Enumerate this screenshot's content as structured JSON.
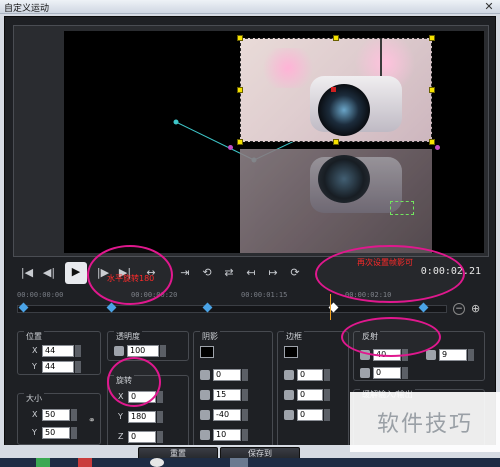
{
  "window": {
    "title": "自定义运动",
    "close": "✕"
  },
  "transport": {
    "buttons": [
      "|◀",
      "◀|",
      "▶",
      "|▶",
      "▶|",
      "↔"
    ],
    "timecode": "0:00:02.21"
  },
  "ruler": {
    "labels": [
      "00:00:00:00",
      "00:00:00:20",
      "00:00:01:15",
      "00:00:02:10"
    ]
  },
  "panels": {
    "position": {
      "title": "位置",
      "x_label": "X",
      "x_value": "44",
      "y_label": "Y",
      "y_value": "44"
    },
    "size": {
      "title": "大小",
      "x_label": "X",
      "x_value": "50",
      "y_label": "Y",
      "y_value": "50"
    },
    "opacity": {
      "title": "透明度",
      "value": "100"
    },
    "rotation": {
      "title": "旋转",
      "x_label": "X",
      "x_value": "0",
      "y_label": "Y",
      "y_value": "180",
      "z_label": "Z",
      "z_value": "0"
    },
    "shadow": {
      "title": "阴影",
      "v1": "0",
      "v2": "15",
      "v3": "-40",
      "v4": "10"
    },
    "border": {
      "title": "边框",
      "v1": "0",
      "v2": "0",
      "v3": "0"
    },
    "reflection": {
      "title": "反射",
      "v1": "40",
      "v2": "9",
      "v3": "0"
    },
    "ease": {
      "title": "缓解输入/输出"
    }
  },
  "annotations": {
    "rotate": "水平旋转180",
    "keyframe": "再次设置帧影可"
  },
  "bottom_buttons": {
    "reset": "重置",
    "save": "保存到"
  },
  "watermark": "软件技巧"
}
